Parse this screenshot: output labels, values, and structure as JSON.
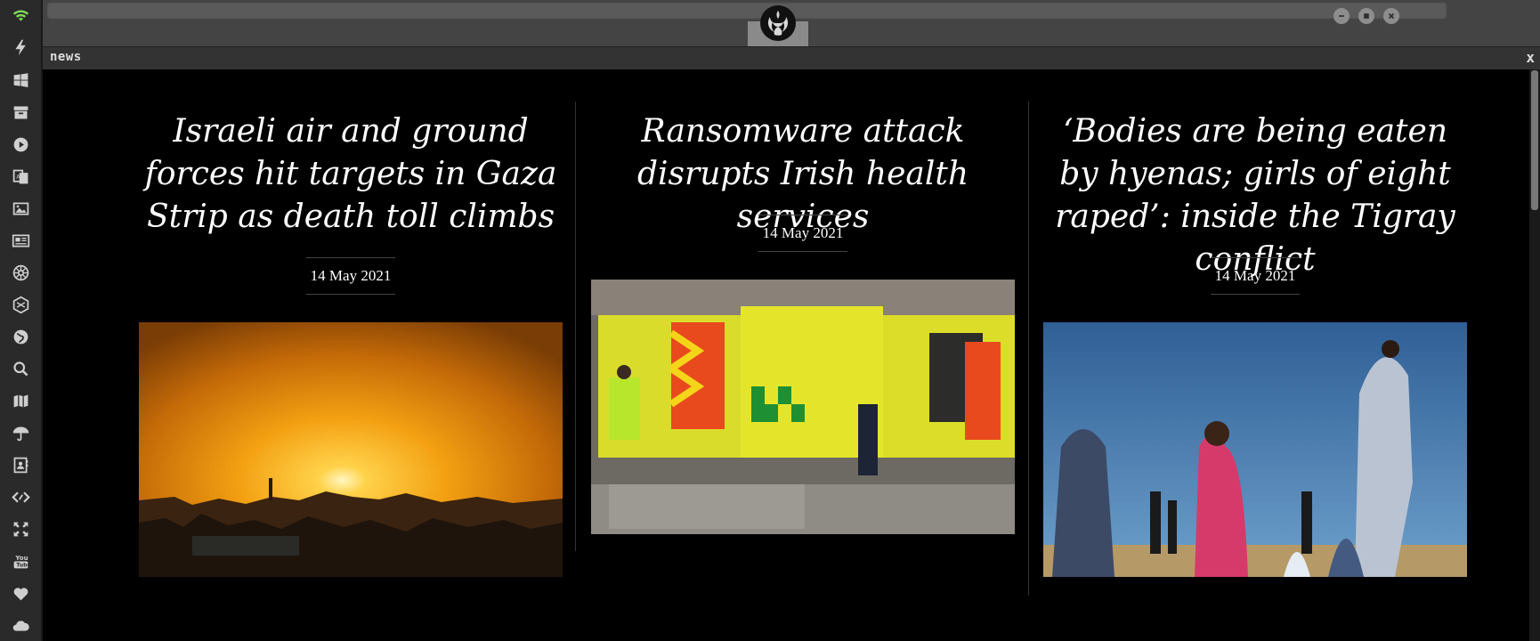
{
  "window": {
    "tab_title": "news",
    "tab_close": "x",
    "controls": [
      "minimize",
      "maximize",
      "close"
    ]
  },
  "sidebar": {
    "icons": [
      "wifi-icon",
      "bolt-icon",
      "windows-icon",
      "archive-icon",
      "play-icon",
      "translate-icon",
      "image-icon",
      "newspaper-icon",
      "galactic-empire-icon",
      "hexagon-icon",
      "globe-icon",
      "search-icon",
      "map-icon",
      "umbrella-icon",
      "contacts-icon",
      "code-icon",
      "expand-icon",
      "youtube-icon",
      "heart-icon",
      "cloud-icon"
    ]
  },
  "colors": {
    "wifi_active": "#7ed957",
    "sidebar_bg": "#2a2a2a",
    "content_bg": "#000000"
  },
  "articles": [
    {
      "headline": "Israeli air and ground forces hit targets in Gaza Strip as death toll climbs",
      "date": "14 May 2021",
      "image": "gaza-sunset-explosion"
    },
    {
      "headline": "Ransomware attack disrupts Irish health services",
      "date": "14 May 2021",
      "image": "irish-ambulances"
    },
    {
      "headline": "‘Bodies are being eaten by hyenas; girls of eight raped’: inside the Tigray conflict",
      "date": "14 May 2021",
      "image": "tigray-people"
    }
  ]
}
